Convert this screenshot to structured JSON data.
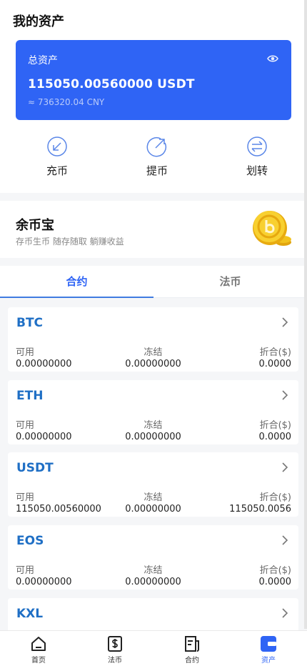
{
  "header": {
    "title": "我的资产"
  },
  "asset_card": {
    "label": "总资产",
    "amount": "115050.00560000 USDT",
    "cny": "≈ 736320.04 CNY"
  },
  "actions": [
    {
      "label": "充币",
      "icon": "deposit-icon"
    },
    {
      "label": "提币",
      "icon": "withdraw-icon"
    },
    {
      "label": "划转",
      "icon": "transfer-icon"
    }
  ],
  "yubibao": {
    "title": "余币宝",
    "subtitle": "存币生币 随存随取 躺赚收益",
    "icon": "gold-coin-icon"
  },
  "tabs": [
    {
      "label": "合约",
      "active": true
    },
    {
      "label": "法币",
      "active": false
    }
  ],
  "column_labels": {
    "available": "可用",
    "frozen": "冻结",
    "converted": "折合($)"
  },
  "assets": [
    {
      "name": "BTC",
      "available": "0.00000000",
      "frozen": "0.00000000",
      "converted": "0.0000"
    },
    {
      "name": "ETH",
      "available": "0.00000000",
      "frozen": "0.00000000",
      "converted": "0.0000"
    },
    {
      "name": "USDT",
      "available": "115050.00560000",
      "frozen": "0.00000000",
      "converted": "115050.0056"
    },
    {
      "name": "EOS",
      "available": "0.00000000",
      "frozen": "0.00000000",
      "converted": "0.0000"
    },
    {
      "name": "KXL",
      "available": "",
      "frozen": "",
      "converted": ""
    }
  ],
  "bottom_nav": [
    {
      "label": "首页",
      "icon": "home-icon",
      "active": false
    },
    {
      "label": "法币",
      "icon": "fiat-icon",
      "active": false
    },
    {
      "label": "合约",
      "icon": "contract-icon",
      "active": false
    },
    {
      "label": "资产",
      "icon": "wallet-icon",
      "active": true
    }
  ],
  "colors": {
    "primary": "#2f64f5",
    "coin_blue": "#1f6fc5",
    "background": "#f5f6f8"
  }
}
